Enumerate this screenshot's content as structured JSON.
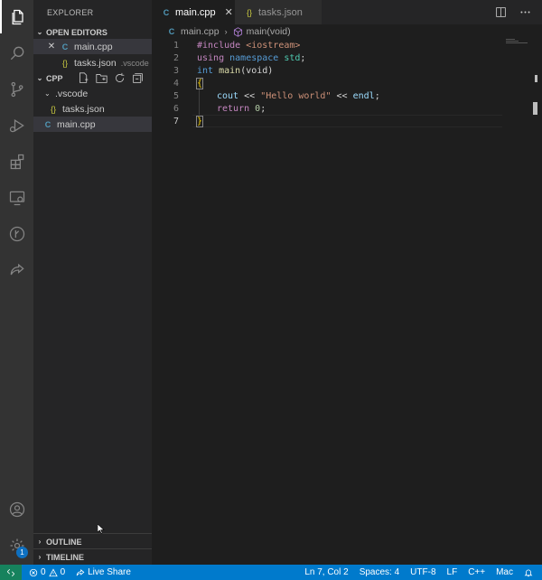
{
  "sidebar": {
    "title": "EXPLORER",
    "open_editors_label": "OPEN EDITORS",
    "open_editors": [
      {
        "name": "main.cpp",
        "icon": "C",
        "detail": ""
      },
      {
        "name": "tasks.json",
        "icon": "{}",
        "detail": ".vscode"
      }
    ],
    "folder_label": "CPP",
    "tree": {
      "vscode_folder": ".vscode",
      "tasks_file": "tasks.json",
      "tasks_icon": "{}",
      "main_file": "main.cpp",
      "main_icon": "C"
    },
    "outline_label": "OUTLINE",
    "timeline_label": "TIMELINE"
  },
  "activity": {
    "badge_count": "1",
    "icons": [
      "files-icon",
      "search-icon",
      "source-control-icon",
      "run-debug-icon",
      "extensions-icon",
      "remote-explorer-icon",
      "git-graph-icon",
      "live-share-icon",
      "account-icon",
      "settings-gear-icon"
    ]
  },
  "tabs": [
    {
      "label": "main.cpp",
      "icon": "C",
      "active": true
    },
    {
      "label": "tasks.json",
      "icon": "{}",
      "active": false
    }
  ],
  "breadcrumb": {
    "file": "main.cpp",
    "file_icon": "C",
    "symbol": "main(void)"
  },
  "editor": {
    "line_numbers": [
      "1",
      "2",
      "3",
      "4",
      "5",
      "6",
      "7"
    ],
    "lines": {
      "l1": {
        "directive": "#include",
        "header": "<iostream>"
      },
      "l2": {
        "using": "using",
        "namespace": "namespace",
        "std": "std",
        "semi": ";"
      },
      "l3": {
        "type": "int",
        "fname": "main",
        "args": "(void)"
      },
      "l4": {
        "brace": "{"
      },
      "l5": {
        "cout": "cout",
        "op1": "<<",
        "str": "\"Hello world\"",
        "op2": "<<",
        "endl": "endl",
        "semi": ";"
      },
      "l6": {
        "ret": "return",
        "num": "0",
        "semi": ";"
      },
      "l7": {
        "brace": "}"
      }
    }
  },
  "status": {
    "errors": "0",
    "warnings": "0",
    "live_share": "Live Share",
    "position": "Ln 7, Col 2",
    "spaces": "Spaces: 4",
    "encoding": "UTF-8",
    "eol": "LF",
    "language": "C++",
    "platform": "Mac"
  },
  "colors": {
    "accent": "#007acc",
    "remote": "#16825d",
    "activity_bg": "#333333",
    "sidebar_bg": "#252526",
    "editor_bg": "#1e1e1e"
  }
}
